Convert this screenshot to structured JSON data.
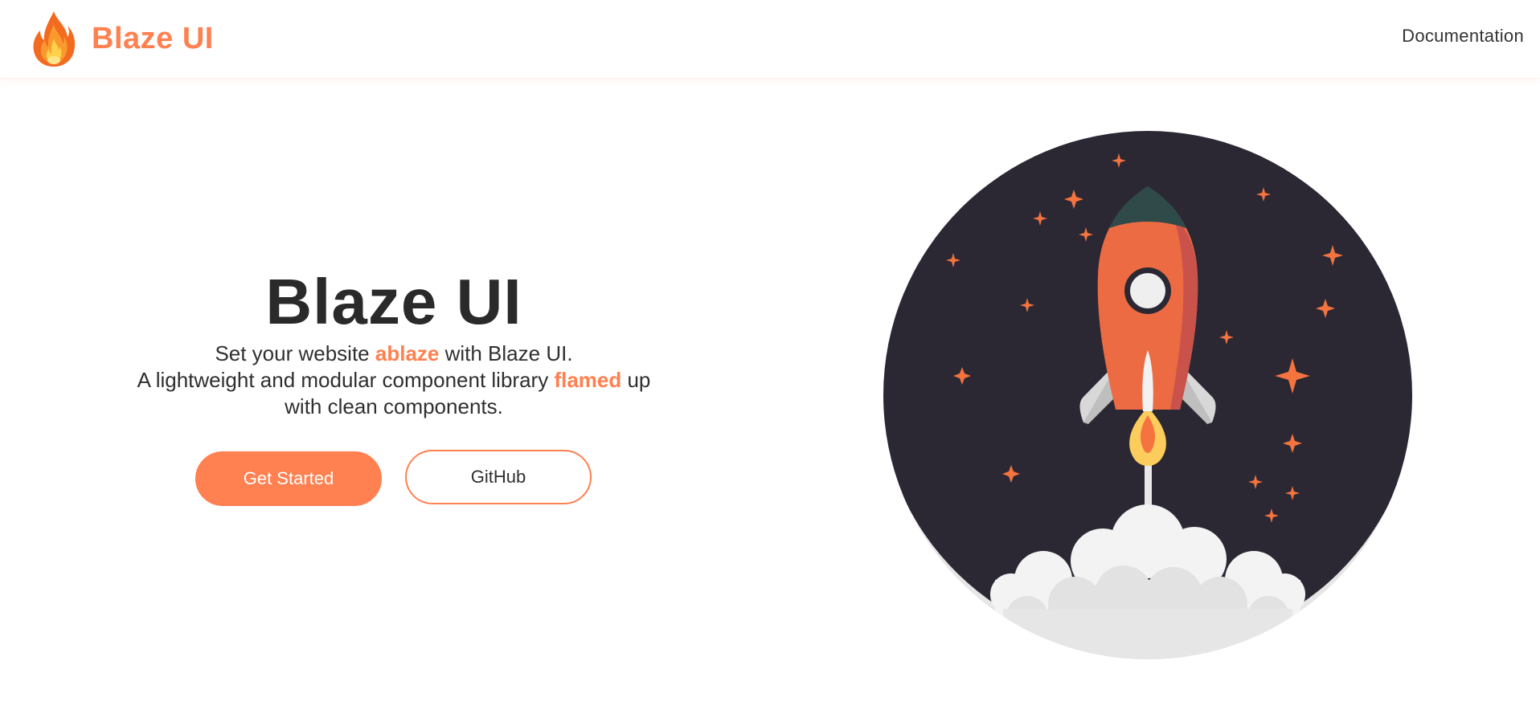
{
  "navbar": {
    "brand_name": "Blaze UI",
    "logo_icon": "flame-icon",
    "nav_links": [
      {
        "label": "Documentation"
      }
    ]
  },
  "hero": {
    "title": "Blaze UI",
    "tagline": {
      "line1_before": "Set your website ",
      "line1_accent": "ablaze",
      "line1_after": " with Blaze UI.",
      "line2_before": "A lightweight and modular component library ",
      "line2_accent": "flamed",
      "line2_after": " up",
      "line3": "with clean components."
    },
    "buttons": {
      "primary_label": "Get Started",
      "secondary_label": "GitHub"
    },
    "illustration_icon": "rocket-launch-illustration"
  },
  "colors": {
    "accent": "#ff8050",
    "text": "#2a2a2a",
    "space_bg": "#2b2833",
    "cloud": "#e6e6e6"
  }
}
